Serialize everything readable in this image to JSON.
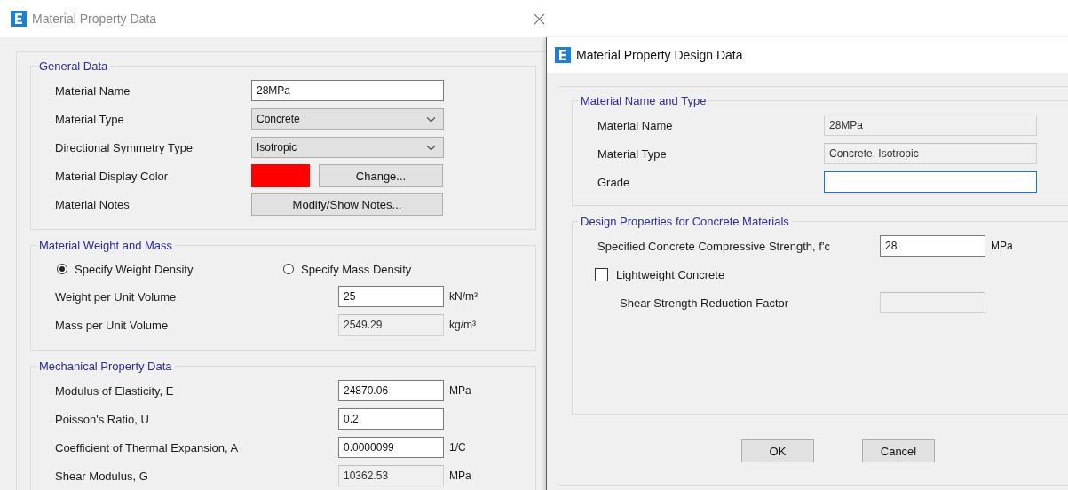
{
  "property_dialog": {
    "title": "Material Property Data",
    "groups": [
      {
        "title": "General Data",
        "rows": [
          {
            "kind": "text",
            "label": "Material Name",
            "value": "28MPa"
          },
          {
            "kind": "select",
            "label": "Material Type",
            "value": "Concrete"
          },
          {
            "kind": "select",
            "label": "Directional Symmetry Type",
            "value": "Isotropic"
          },
          {
            "kind": "color",
            "label": "Material Display Color",
            "color": "#ff0000",
            "button": "Change..."
          },
          {
            "kind": "button",
            "label": "Material Notes",
            "button": "Modify/Show Notes..."
          }
        ]
      },
      {
        "title": "Material Weight and Mass",
        "radios": [
          {
            "label": "Specify Weight Density",
            "selected": true
          },
          {
            "label": "Specify Mass Density",
            "selected": false
          }
        ],
        "rows": [
          {
            "kind": "text",
            "label": "Weight per Unit Volume",
            "value": "25",
            "unit": "kN/m³",
            "disabled": false
          },
          {
            "kind": "text",
            "label": "Mass per Unit Volume",
            "value": "2549.29",
            "unit": "kg/m³",
            "disabled": true
          }
        ]
      },
      {
        "title": "Mechanical Property Data",
        "rows": [
          {
            "kind": "text",
            "label": "Modulus of Elasticity,  E",
            "value": "24870.06",
            "unit": "MPa",
            "disabled": false
          },
          {
            "kind": "text",
            "label": "Poisson's Ratio,  U",
            "value": "0.2",
            "disabled": false
          },
          {
            "kind": "text",
            "label": "Coefficient of Thermal Expansion,  A",
            "value": "0.0000099",
            "unit": "1/C",
            "disabled": false
          },
          {
            "kind": "text",
            "label": "Shear Modulus,  G",
            "value": "10362.53",
            "unit": "MPa",
            "disabled": true
          }
        ]
      }
    ]
  },
  "design_dialog": {
    "title": "Material Property Design Data",
    "groups": [
      {
        "title": "Material Name and Type",
        "rows": [
          {
            "kind": "text",
            "label": "Material Name",
            "value": "28MPa",
            "disabled": true
          },
          {
            "kind": "text",
            "label": "Material Type",
            "value": "Concrete, Isotropic",
            "disabled": true
          },
          {
            "kind": "text",
            "label": "Grade",
            "disabled": false,
            "focused": true
          }
        ]
      },
      {
        "title": "Design Properties for Concrete Materials",
        "rows": [
          {
            "kind": "text",
            "label": "Specified Concrete Compressive Strength, f'c",
            "value": "28",
            "unit": "MPa",
            "disabled": false
          },
          {
            "kind": "checkbox",
            "label": "Lightweight Concrete",
            "checked": false
          },
          {
            "kind": "subtext",
            "label": "Shear Strength Reduction Factor",
            "disabled": true
          }
        ]
      }
    ],
    "buttons": [
      "OK",
      "Cancel"
    ]
  }
}
